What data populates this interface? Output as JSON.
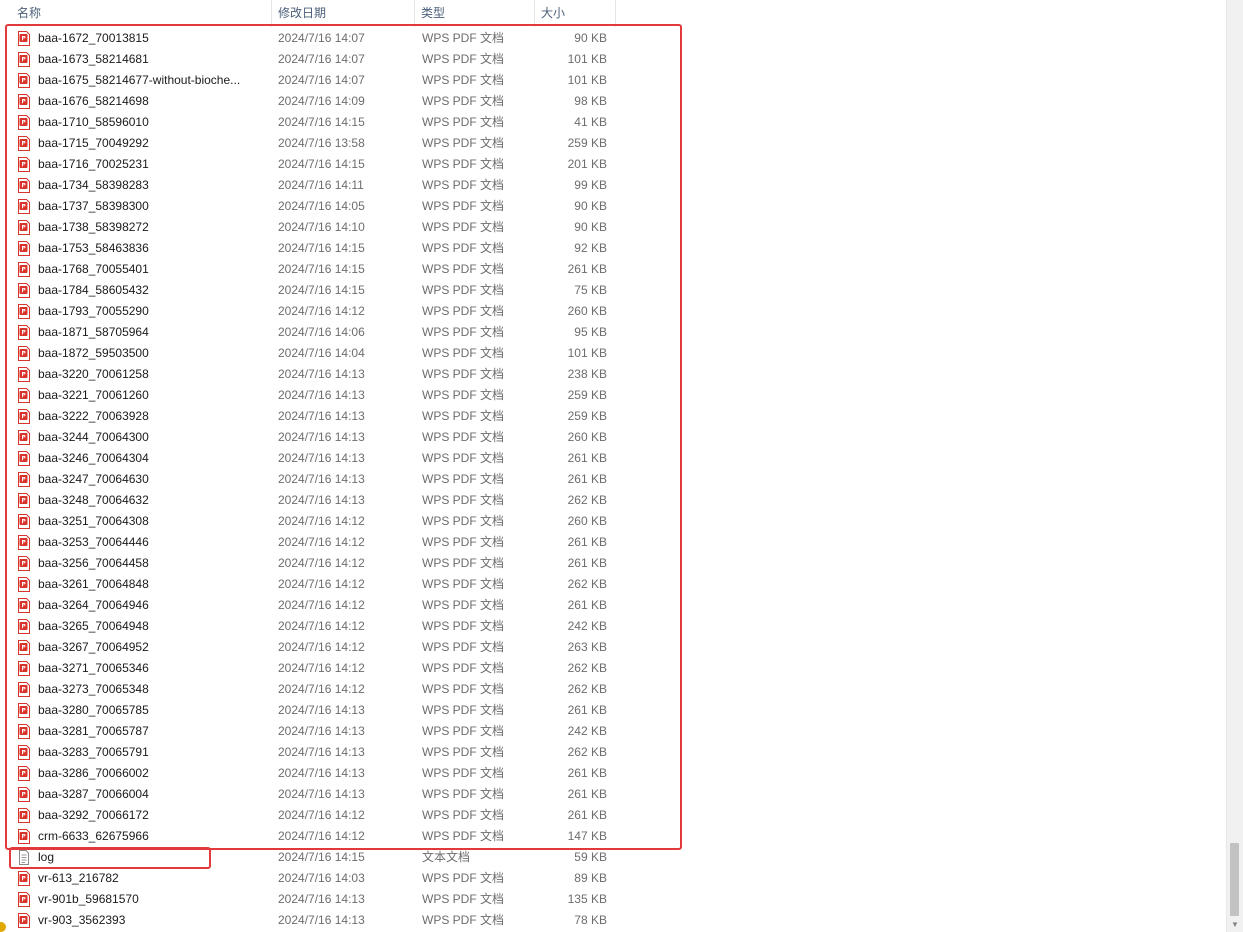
{
  "columns": {
    "name": "名称",
    "date": "修改日期",
    "type": "类型",
    "size": "大小",
    "sort_indicator": "^"
  },
  "files": [
    {
      "name": "baa-1672_70013815",
      "date": "2024/7/16 14:07",
      "type": "WPS PDF 文档",
      "size": "90 KB",
      "icon": "pdf-icon"
    },
    {
      "name": "baa-1673_58214681",
      "date": "2024/7/16 14:07",
      "type": "WPS PDF 文档",
      "size": "101 KB",
      "icon": "pdf-icon"
    },
    {
      "name": "baa-1675_58214677-without-bioche...",
      "date": "2024/7/16 14:07",
      "type": "WPS PDF 文档",
      "size": "101 KB",
      "icon": "pdf-icon"
    },
    {
      "name": "baa-1676_58214698",
      "date": "2024/7/16 14:09",
      "type": "WPS PDF 文档",
      "size": "98 KB",
      "icon": "pdf-icon"
    },
    {
      "name": "baa-1710_58596010",
      "date": "2024/7/16 14:15",
      "type": "WPS PDF 文档",
      "size": "41 KB",
      "icon": "pdf-icon"
    },
    {
      "name": "baa-1715_70049292",
      "date": "2024/7/16 13:58",
      "type": "WPS PDF 文档",
      "size": "259 KB",
      "icon": "pdf-icon"
    },
    {
      "name": "baa-1716_70025231",
      "date": "2024/7/16 14:15",
      "type": "WPS PDF 文档",
      "size": "201 KB",
      "icon": "pdf-icon"
    },
    {
      "name": "baa-1734_58398283",
      "date": "2024/7/16 14:11",
      "type": "WPS PDF 文档",
      "size": "99 KB",
      "icon": "pdf-icon"
    },
    {
      "name": "baa-1737_58398300",
      "date": "2024/7/16 14:05",
      "type": "WPS PDF 文档",
      "size": "90 KB",
      "icon": "pdf-icon"
    },
    {
      "name": "baa-1738_58398272",
      "date": "2024/7/16 14:10",
      "type": "WPS PDF 文档",
      "size": "90 KB",
      "icon": "pdf-icon"
    },
    {
      "name": "baa-1753_58463836",
      "date": "2024/7/16 14:15",
      "type": "WPS PDF 文档",
      "size": "92 KB",
      "icon": "pdf-icon"
    },
    {
      "name": "baa-1768_70055401",
      "date": "2024/7/16 14:15",
      "type": "WPS PDF 文档",
      "size": "261 KB",
      "icon": "pdf-icon"
    },
    {
      "name": "baa-1784_58605432",
      "date": "2024/7/16 14:15",
      "type": "WPS PDF 文档",
      "size": "75 KB",
      "icon": "pdf-icon"
    },
    {
      "name": "baa-1793_70055290",
      "date": "2024/7/16 14:12",
      "type": "WPS PDF 文档",
      "size": "260 KB",
      "icon": "pdf-icon"
    },
    {
      "name": "baa-1871_58705964",
      "date": "2024/7/16 14:06",
      "type": "WPS PDF 文档",
      "size": "95 KB",
      "icon": "pdf-icon"
    },
    {
      "name": "baa-1872_59503500",
      "date": "2024/7/16 14:04",
      "type": "WPS PDF 文档",
      "size": "101 KB",
      "icon": "pdf-icon"
    },
    {
      "name": "baa-3220_70061258",
      "date": "2024/7/16 14:13",
      "type": "WPS PDF 文档",
      "size": "238 KB",
      "icon": "pdf-icon"
    },
    {
      "name": "baa-3221_70061260",
      "date": "2024/7/16 14:13",
      "type": "WPS PDF 文档",
      "size": "259 KB",
      "icon": "pdf-icon"
    },
    {
      "name": "baa-3222_70063928",
      "date": "2024/7/16 14:13",
      "type": "WPS PDF 文档",
      "size": "259 KB",
      "icon": "pdf-icon"
    },
    {
      "name": "baa-3244_70064300",
      "date": "2024/7/16 14:13",
      "type": "WPS PDF 文档",
      "size": "260 KB",
      "icon": "pdf-icon"
    },
    {
      "name": "baa-3246_70064304",
      "date": "2024/7/16 14:13",
      "type": "WPS PDF 文档",
      "size": "261 KB",
      "icon": "pdf-icon"
    },
    {
      "name": "baa-3247_70064630",
      "date": "2024/7/16 14:13",
      "type": "WPS PDF 文档",
      "size": "261 KB",
      "icon": "pdf-icon"
    },
    {
      "name": "baa-3248_70064632",
      "date": "2024/7/16 14:13",
      "type": "WPS PDF 文档",
      "size": "262 KB",
      "icon": "pdf-icon"
    },
    {
      "name": "baa-3251_70064308",
      "date": "2024/7/16 14:12",
      "type": "WPS PDF 文档",
      "size": "260 KB",
      "icon": "pdf-icon"
    },
    {
      "name": "baa-3253_70064446",
      "date": "2024/7/16 14:12",
      "type": "WPS PDF 文档",
      "size": "261 KB",
      "icon": "pdf-icon"
    },
    {
      "name": "baa-3256_70064458",
      "date": "2024/7/16 14:12",
      "type": "WPS PDF 文档",
      "size": "261 KB",
      "icon": "pdf-icon"
    },
    {
      "name": "baa-3261_70064848",
      "date": "2024/7/16 14:12",
      "type": "WPS PDF 文档",
      "size": "262 KB",
      "icon": "pdf-icon"
    },
    {
      "name": "baa-3264_70064946",
      "date": "2024/7/16 14:12",
      "type": "WPS PDF 文档",
      "size": "261 KB",
      "icon": "pdf-icon"
    },
    {
      "name": "baa-3265_70064948",
      "date": "2024/7/16 14:12",
      "type": "WPS PDF 文档",
      "size": "242 KB",
      "icon": "pdf-icon"
    },
    {
      "name": "baa-3267_70064952",
      "date": "2024/7/16 14:12",
      "type": "WPS PDF 文档",
      "size": "263 KB",
      "icon": "pdf-icon"
    },
    {
      "name": "baa-3271_70065346",
      "date": "2024/7/16 14:12",
      "type": "WPS PDF 文档",
      "size": "262 KB",
      "icon": "pdf-icon"
    },
    {
      "name": "baa-3273_70065348",
      "date": "2024/7/16 14:12",
      "type": "WPS PDF 文档",
      "size": "262 KB",
      "icon": "pdf-icon"
    },
    {
      "name": "baa-3280_70065785",
      "date": "2024/7/16 14:13",
      "type": "WPS PDF 文档",
      "size": "261 KB",
      "icon": "pdf-icon"
    },
    {
      "name": "baa-3281_70065787",
      "date": "2024/7/16 14:13",
      "type": "WPS PDF 文档",
      "size": "242 KB",
      "icon": "pdf-icon"
    },
    {
      "name": "baa-3283_70065791",
      "date": "2024/7/16 14:13",
      "type": "WPS PDF 文档",
      "size": "262 KB",
      "icon": "pdf-icon"
    },
    {
      "name": "baa-3286_70066002",
      "date": "2024/7/16 14:13",
      "type": "WPS PDF 文档",
      "size": "261 KB",
      "icon": "pdf-icon"
    },
    {
      "name": "baa-3287_70066004",
      "date": "2024/7/16 14:13",
      "type": "WPS PDF 文档",
      "size": "261 KB",
      "icon": "pdf-icon"
    },
    {
      "name": "baa-3292_70066172",
      "date": "2024/7/16 14:12",
      "type": "WPS PDF 文档",
      "size": "261 KB",
      "icon": "pdf-icon"
    },
    {
      "name": "crm-6633_62675966",
      "date": "2024/7/16 14:12",
      "type": "WPS PDF 文档",
      "size": "147 KB",
      "icon": "pdf-icon"
    },
    {
      "name": "log",
      "date": "2024/7/16 14:15",
      "type": "文本文档",
      "size": "59 KB",
      "icon": "text-file-icon"
    },
    {
      "name": "vr-613_216782",
      "date": "2024/7/16 14:03",
      "type": "WPS PDF 文档",
      "size": "89 KB",
      "icon": "pdf-icon"
    },
    {
      "name": "vr-901b_59681570",
      "date": "2024/7/16 14:13",
      "type": "WPS PDF 文档",
      "size": "135 KB",
      "icon": "pdf-icon"
    },
    {
      "name": "vr-903_3562393",
      "date": "2024/7/16 14:13",
      "type": "WPS PDF 文档",
      "size": "78 KB",
      "icon": "pdf-icon"
    }
  ],
  "colors": {
    "highlight_border": "#e23a3a",
    "pdf_icon": "#d9342b",
    "header_text": "#4c607a",
    "secondary_text": "#6d6d6d"
  }
}
